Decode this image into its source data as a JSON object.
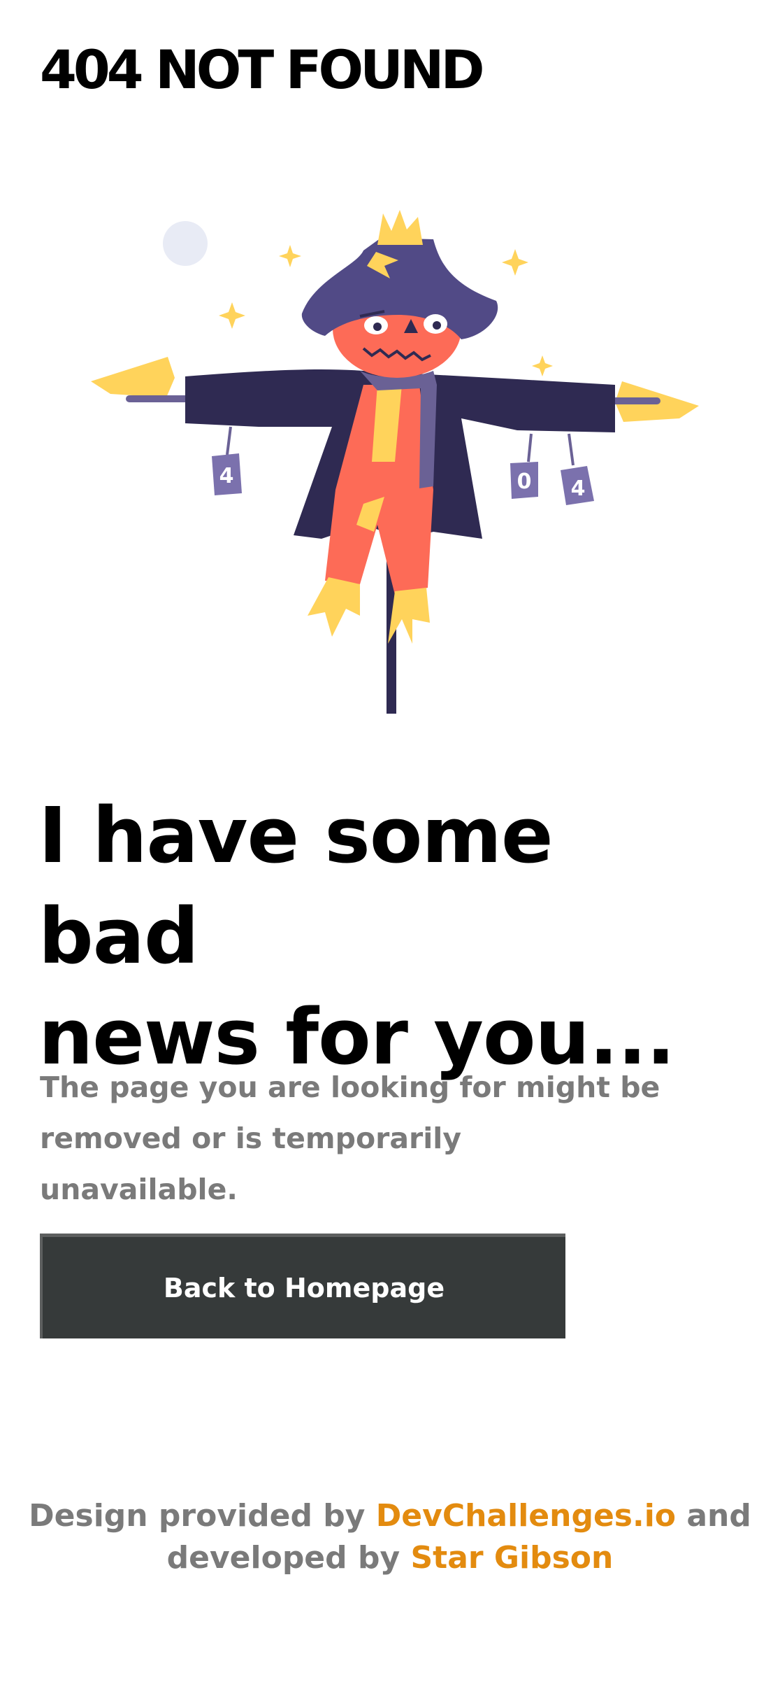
{
  "brand": {
    "text": "404 NOT FOUND"
  },
  "illustration": {
    "name": "scarecrow-illustration",
    "can_labels": [
      "4",
      "0",
      "4"
    ],
    "colors": {
      "hat": "#514a86",
      "coat": "#2f2a52",
      "face": "#fd6b57",
      "straw": "#ffd35b",
      "scarf": "#6a6195",
      "pole": "#2f2a52",
      "moon": "#e8ebf5"
    }
  },
  "headline": {
    "line1": "I have some bad",
    "line2": "news for you..."
  },
  "description": {
    "line1": "The page you are looking for might be",
    "line2": "removed or is temporarily unavailable."
  },
  "cta": {
    "label": "Back to Homepage"
  },
  "footer": {
    "prefix": "Design provided by",
    "link1": "DevChallenges.io",
    "middle": "and",
    "line2_prefix": "developed by",
    "link2": "Star Gibson",
    "link_color": "#e38b0f"
  }
}
